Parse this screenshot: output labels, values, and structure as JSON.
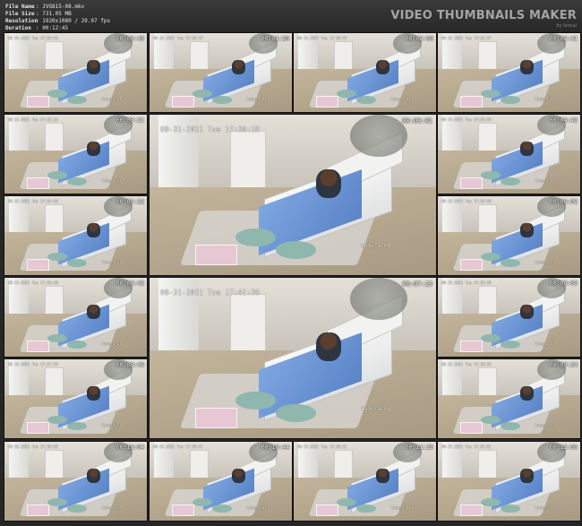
{
  "info": [
    {
      "key": "File Name",
      "value": ": JVG815-08.mkv"
    },
    {
      "key": "File Size",
      "value": ": 731.05 MB"
    },
    {
      "key": "Resolution",
      "value": ": 1920x1080 / 29.97 fps"
    },
    {
      "key": "Duration",
      "value": ": 00:12:45"
    }
  ],
  "brand": {
    "title": "VIDEO THUMBNAILS MAKER",
    "subtitle": "by Ioncal"
  },
  "camera_label": "Camera 01",
  "thumbnails": [
    {
      "ts": "08-31-2021 Tue 17:29:59",
      "dur": "00:00:40"
    },
    {
      "ts": "08-31-2021 Tue 17:30:17",
      "dur": "00:01:20"
    },
    {
      "ts": "08-31-2021 Tue 17:30:57",
      "dur": "00:02:00"
    },
    {
      "ts": "08-31-2021 Tue 17:31:37",
      "dur": "00:02:41"
    },
    {
      "ts": "08-31-2021 Tue 17:32:18",
      "dur": "00:03:21"
    },
    {
      "ts": "08-31-2021 Tue 17:30:18",
      "dur": "00:03:01",
      "big": true
    },
    {
      "ts": "08-31-2021 Tue 17:33:38",
      "dur": "00:04:42"
    },
    {
      "ts": "08-31-2021 Tue 17:34:18",
      "dur": "00:05:22"
    },
    {
      "ts": "08-31-2021 Tue 17:34:58",
      "dur": "00:06:02"
    },
    {
      "ts": "08-31-2021 Tue 17:35:38",
      "dur": "00:06:42"
    },
    {
      "ts": "08-31-2021 Tue 17:41:39",
      "dur": "00:07:23",
      "big": true
    },
    {
      "ts": "08-31-2021 Tue 17:36:59",
      "dur": "00:08:03"
    },
    {
      "ts": "08-31-2021 Tue 17:37:39",
      "dur": "00:08:43"
    },
    {
      "ts": "08-31-2021 Tue 17:38:20",
      "dur": "00:09:24"
    },
    {
      "ts": "08-31-2021 Tue 17:39:00",
      "dur": "00:10:04"
    },
    {
      "ts": "08-31-2021 Tue 17:39:41",
      "dur": "00:10:44"
    },
    {
      "ts": "08-31-2021 Tue 17:40:21",
      "dur": "00:11:25"
    },
    {
      "ts": "08-31-2021 Tue 17:41:01",
      "dur": "00:12:05"
    }
  ]
}
